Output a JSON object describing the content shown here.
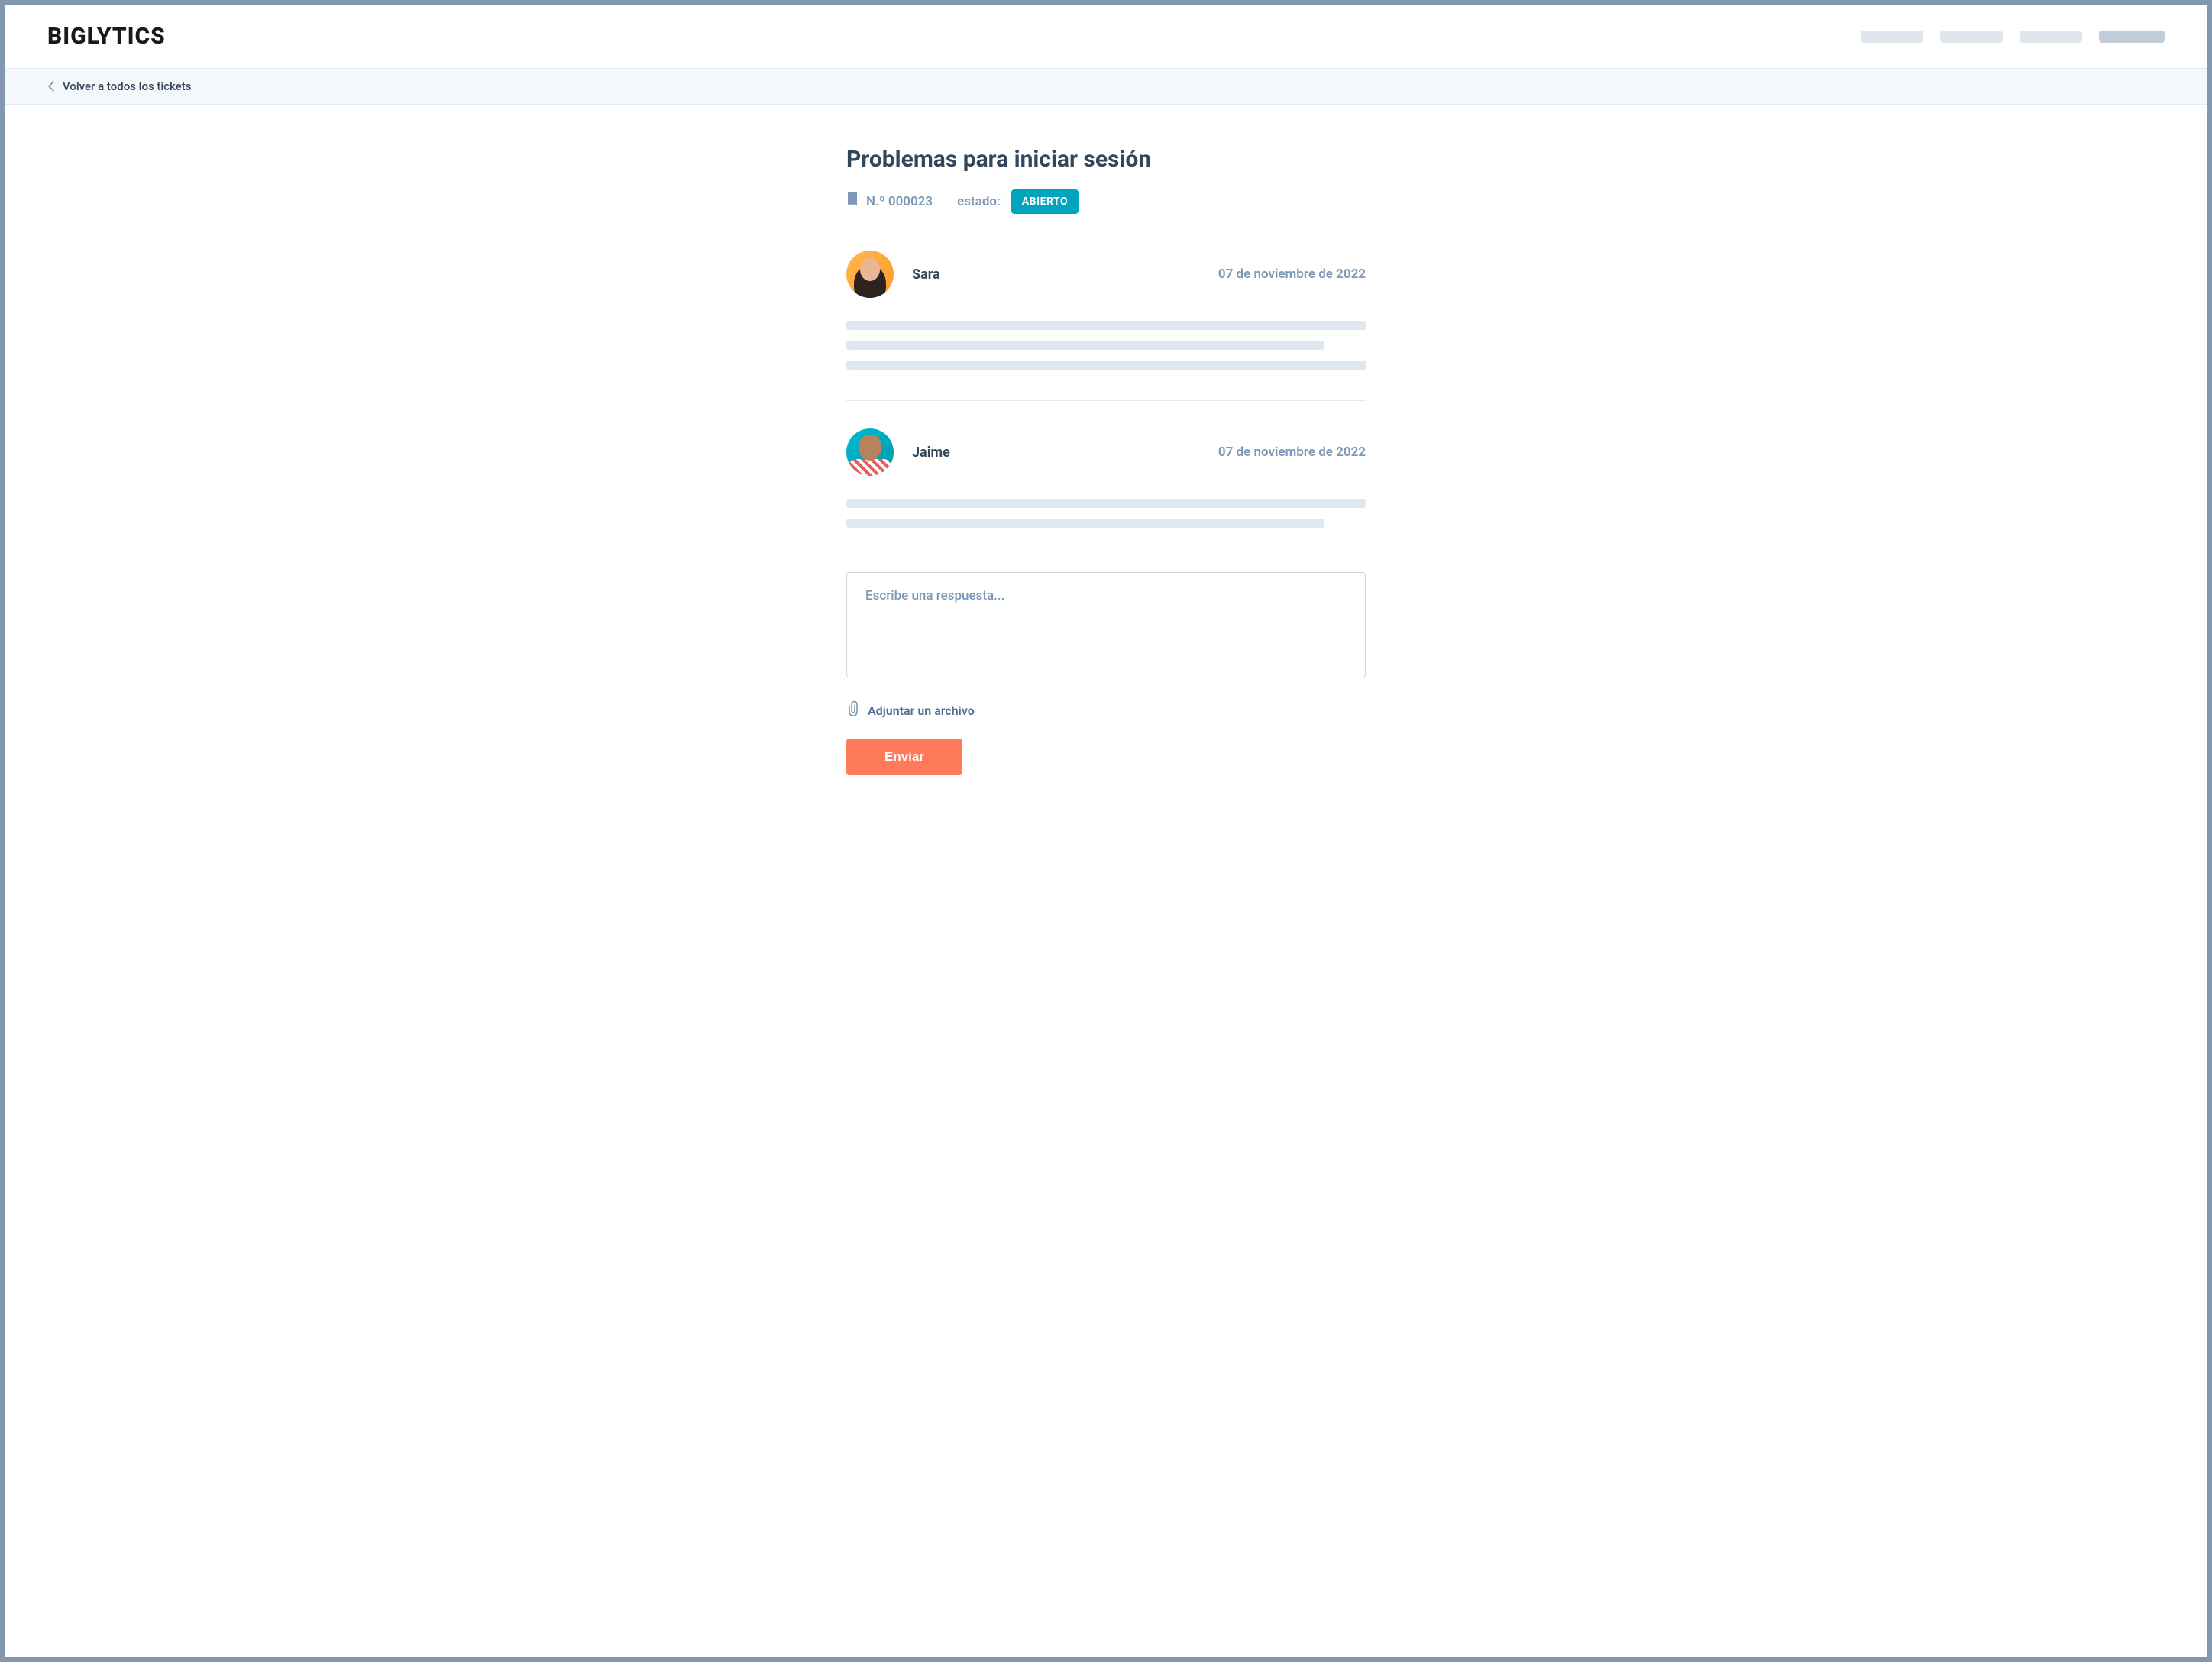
{
  "header": {
    "logo": "BIGLYTICS"
  },
  "breadcrumb": {
    "back_label": "Volver a todos los tickets"
  },
  "ticket": {
    "title": "Problemas para iniciar sesión",
    "number": "N.º 000023",
    "status_label": "estado:",
    "status_value": "ABIERTO"
  },
  "messages": [
    {
      "author": "Sara",
      "date": "07 de noviembre de 2022"
    },
    {
      "author": "Jaime",
      "date": "07 de noviembre de 2022"
    }
  ],
  "reply": {
    "placeholder": "Escribe una respuesta...",
    "attach_label": "Adjuntar un archivo",
    "submit_label": "Enviar"
  }
}
